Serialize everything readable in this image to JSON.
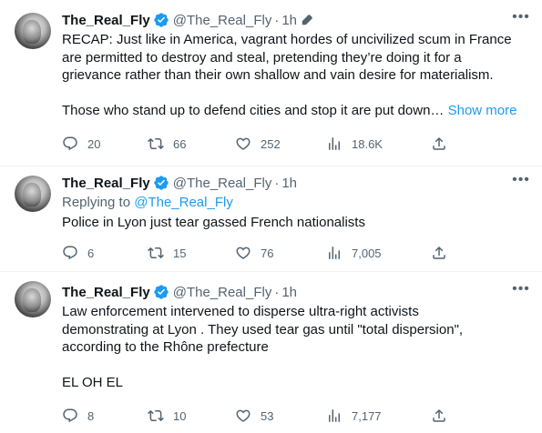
{
  "colors": {
    "accent": "#1d9bf0",
    "muted": "#536471",
    "text": "#0f1419",
    "divider": "#eff3f4"
  },
  "tweets": [
    {
      "name": "The_Real_Fly",
      "handle": "@The_Real_Fly",
      "time": "1h",
      "edited": true,
      "lines": [
        "RECAP: Just like in America, vagrant hordes of uncivilized scum in France",
        "are permitted to destroy and steal, pretending they’re doing it for a",
        "grievance rather than their own shallow and vain desire for materialism.",
        "",
        "Those who stand up to defend cities and stop it are put down…"
      ],
      "show_more": "Show more",
      "replies": "20",
      "retweets": "66",
      "likes": "252",
      "views": "18.6K"
    },
    {
      "name": "The_Real_Fly",
      "handle": "@The_Real_Fly",
      "time": "1h",
      "replying_prefix": "Replying to",
      "replying_handle": "@The_Real_Fly",
      "lines": [
        "Police in Lyon just tear gassed French nationalists"
      ],
      "replies": "6",
      "retweets": "15",
      "likes": "76",
      "views": "7,005"
    },
    {
      "name": "The_Real_Fly",
      "handle": "@The_Real_Fly",
      "time": "1h",
      "lines": [
        "Law enforcement intervened to disperse ultra-right activists",
        "demonstrating at Lyon . They used tear gas until \"total dispersion\",",
        "according to the Rhône prefecture",
        "",
        "EL OH EL"
      ],
      "replies": "8",
      "retweets": "10",
      "likes": "53",
      "views": "7,177"
    }
  ],
  "icons": {
    "verified": "verified-badge-icon",
    "edit": "pencil-icon",
    "more": "more-icon",
    "reply": "reply-icon",
    "retweet": "retweet-icon",
    "like": "like-icon",
    "views": "views-icon",
    "share": "share-icon"
  }
}
